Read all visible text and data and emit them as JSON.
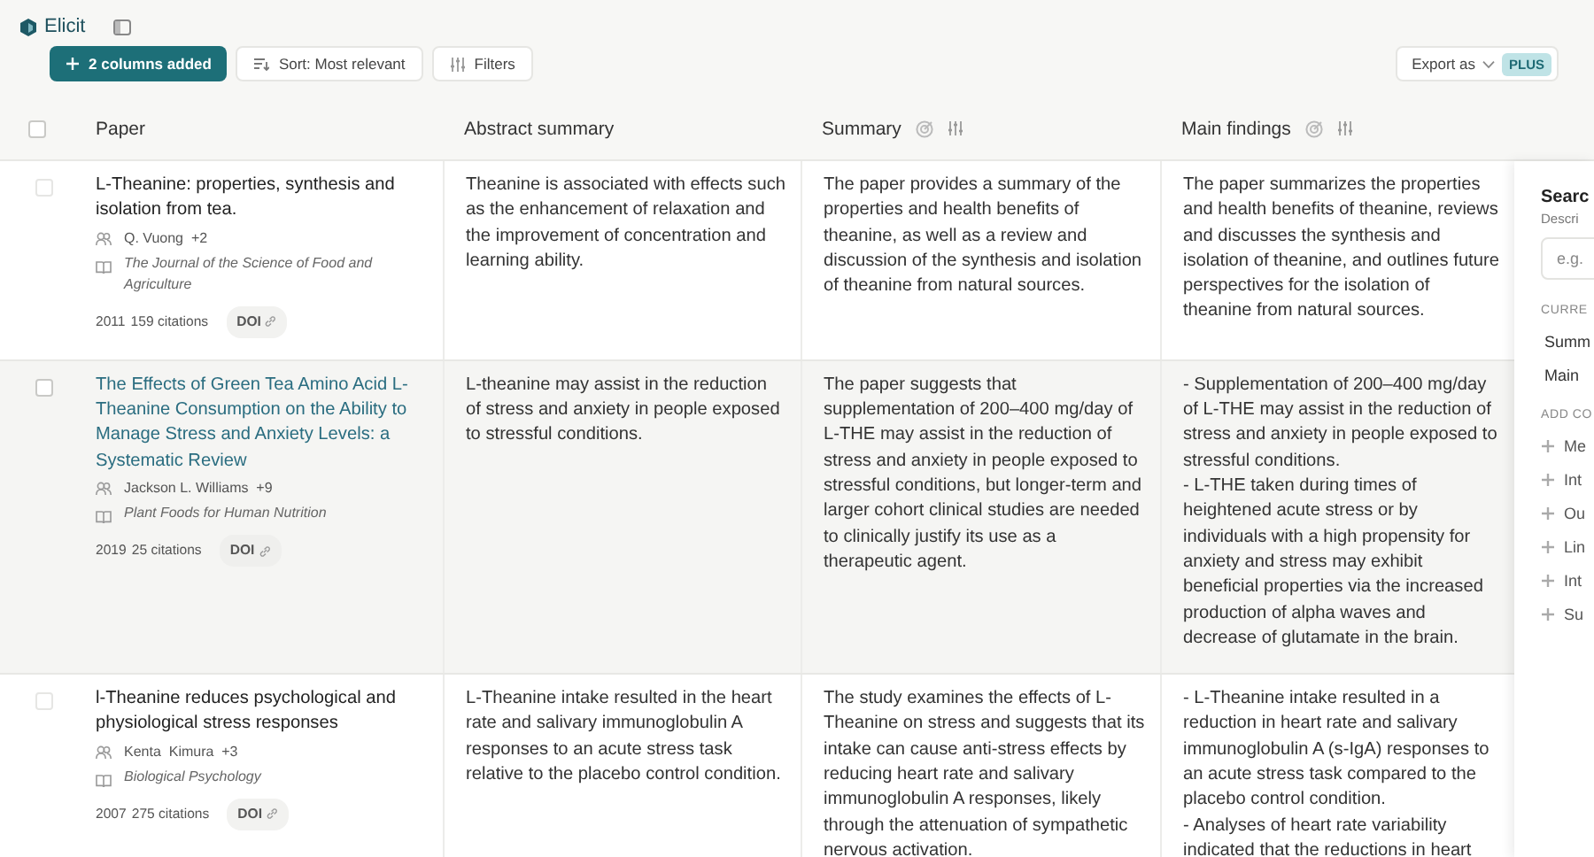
{
  "app": {
    "name": "Elicit"
  },
  "toolbar": {
    "columns_button": "2 columns added",
    "sort_button": "Sort: Most relevant",
    "filters_button": "Filters",
    "export_button": "Export as",
    "export_badge": "PLUS"
  },
  "table": {
    "header_checkbox": {
      "checked": false
    },
    "columns": [
      {
        "label": "Paper",
        "actions": false
      },
      {
        "label": "Abstract summary",
        "actions": false
      },
      {
        "label": "Summary",
        "actions": true
      },
      {
        "label": "Main findings",
        "actions": true
      }
    ],
    "rows": [
      {
        "hovered": false,
        "checked": false,
        "title": "L-Theanine: properties, synthesis and isolation from tea.",
        "authors": "Q. Vuong  +2",
        "journal": "The Journal of the Science of Food and Agriculture",
        "year": "2011",
        "citations": "159 citations",
        "doi": "DOI",
        "abstract_summary": "Theanine is associated with effects such as the enhancement of relaxation and the improvement of concentration and learning ability.",
        "summary": "The paper provides a summary of the properties and health benefits of theanine, as well as a review and discussion of the synthesis and isolation of theanine from natural sources.",
        "main_findings": "The paper summarizes the properties and health benefits of theanine, reviews and discusses the synthesis and isolation of theanine, and outlines future perspectives for the isolation of theanine from natural sources."
      },
      {
        "hovered": true,
        "checked": false,
        "title": "The Effects of Green Tea Amino Acid L-Theanine Consumption on the Ability to Manage Stress and Anxiety Levels: a Systematic Review",
        "authors": "Jackson L. Williams  +9",
        "journal": "Plant Foods for Human Nutrition",
        "year": "2019",
        "citations": "25 citations",
        "doi": "DOI",
        "abstract_summary": "L-theanine may assist in the reduction of stress and anxiety in people exposed to stressful conditions.",
        "summary": "The paper suggests that supplementation of 200–400 mg/day of L-THE may assist in the reduction of stress and anxiety in people exposed to stressful conditions, but longer-term and larger cohort clinical studies are needed to clinically justify its use as a therapeutic agent.",
        "main_findings": "- Supplementation of 200–400 mg/day of L-THE may assist in the reduction of stress and anxiety in people exposed to stressful conditions.\n- L-THE taken during times of heightened acute stress or by individuals with a high propensity for anxiety and stress may exhibit beneficial properties via the increased production of alpha waves and decrease of glutamate in the brain."
      },
      {
        "hovered": false,
        "checked": false,
        "title": "l-Theanine reduces psychological and physiological stress responses",
        "authors": "Kenta  Kimura  +3",
        "journal": "Biological Psychology",
        "year": "2007",
        "citations": "275 citations",
        "doi": "DOI",
        "abstract_summary": "L-Theanine intake resulted in the heart rate and salivary immunoglobulin A responses to an acute stress task relative to the placebo control condition.",
        "summary": "The study examines the effects of L-Theanine on stress and suggests that its intake can cause anti-stress effects by reducing heart rate and salivary immunoglobulin A responses, likely through the attenuation of sympathetic nervous activation.",
        "main_findings": "- L-Theanine intake resulted in a reduction in heart rate and salivary immunoglobulin A (s-IgA) responses to an acute stress task compared to the placebo control condition.\n- Analyses of heart rate variability indicated that the reductions in heart"
      }
    ]
  },
  "panel": {
    "title": "Searc",
    "subtitle": "Descri",
    "search": {
      "placeholder": "e.g."
    },
    "current_heading": "CURRE",
    "current_columns": [
      "Summ",
      "Main"
    ],
    "add_heading": "ADD CO",
    "add_columns": [
      "Me",
      "Int",
      "Ou",
      "Lin",
      "Int",
      "Su"
    ]
  }
}
